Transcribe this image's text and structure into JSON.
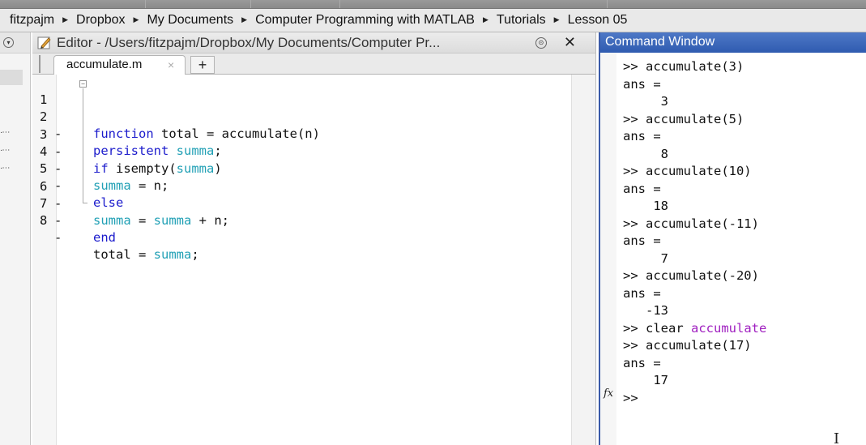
{
  "breadcrumb": [
    "fitzpajm",
    "Dropbox",
    "My Documents",
    "Computer Programming with MATLAB",
    "Tutorials",
    "Lesson 05"
  ],
  "editor": {
    "title": "Editor - /Users/fitzpajm/Dropbox/My Documents/Computer Pr...",
    "minimize_glyph": "⊙",
    "close_glyph": "✕",
    "tab_label": "accumulate.m",
    "tab_close_glyph": "×",
    "new_tab_glyph": "+",
    "status_color": "#33c433",
    "lines": [
      {
        "num": "1",
        "dash": ""
      },
      {
        "num": "2",
        "dash": "-"
      },
      {
        "num": "3",
        "dash": "-"
      },
      {
        "num": "4",
        "dash": "-"
      },
      {
        "num": "5",
        "dash": "-"
      },
      {
        "num": "6",
        "dash": "-"
      },
      {
        "num": "7",
        "dash": "-"
      },
      {
        "num": "8",
        "dash": "-"
      }
    ],
    "code": {
      "l1_kw": "function",
      "l1_rest": " total = accumulate(n)",
      "l2_kw": "persistent",
      "l2_var": "summa",
      "l2_rest": ";",
      "l3_kw": "if",
      "l3_a": " isempty(",
      "l3_var": "summa",
      "l3_b": ")",
      "l4_var": "summa",
      "l4_rest": " = n;",
      "l5_kw": "else",
      "l6_var1": "summa",
      "l6_mid": " = ",
      "l6_var2": "summa",
      "l6_rest": " + n;",
      "l7_kw": "end",
      "l8_a": "total = ",
      "l8_var": "summa",
      "l8_b": ";"
    }
  },
  "command_window": {
    "title": "Command Window",
    "lines": [
      ">> accumulate(3)",
      "ans =",
      "     3",
      ">> accumulate(5)",
      "ans =",
      "     8",
      ">> accumulate(10)",
      "ans =",
      "    18",
      ">> accumulate(-11)",
      "ans =",
      "     7",
      ">> accumulate(-20)",
      "ans =",
      "   -13"
    ],
    "clear_prefix": ">> clear ",
    "clear_arg": "accumulate",
    "lines_after": [
      ">> accumulate(17)",
      "ans =",
      "    17"
    ],
    "prompt": ">>",
    "fx_label": "fx"
  },
  "colors": {
    "keyword": "#1c1ccc",
    "persistent_var": "#21a0b5",
    "command_window_title": "#2f5bb0",
    "clear_arg": "#a020c0"
  }
}
